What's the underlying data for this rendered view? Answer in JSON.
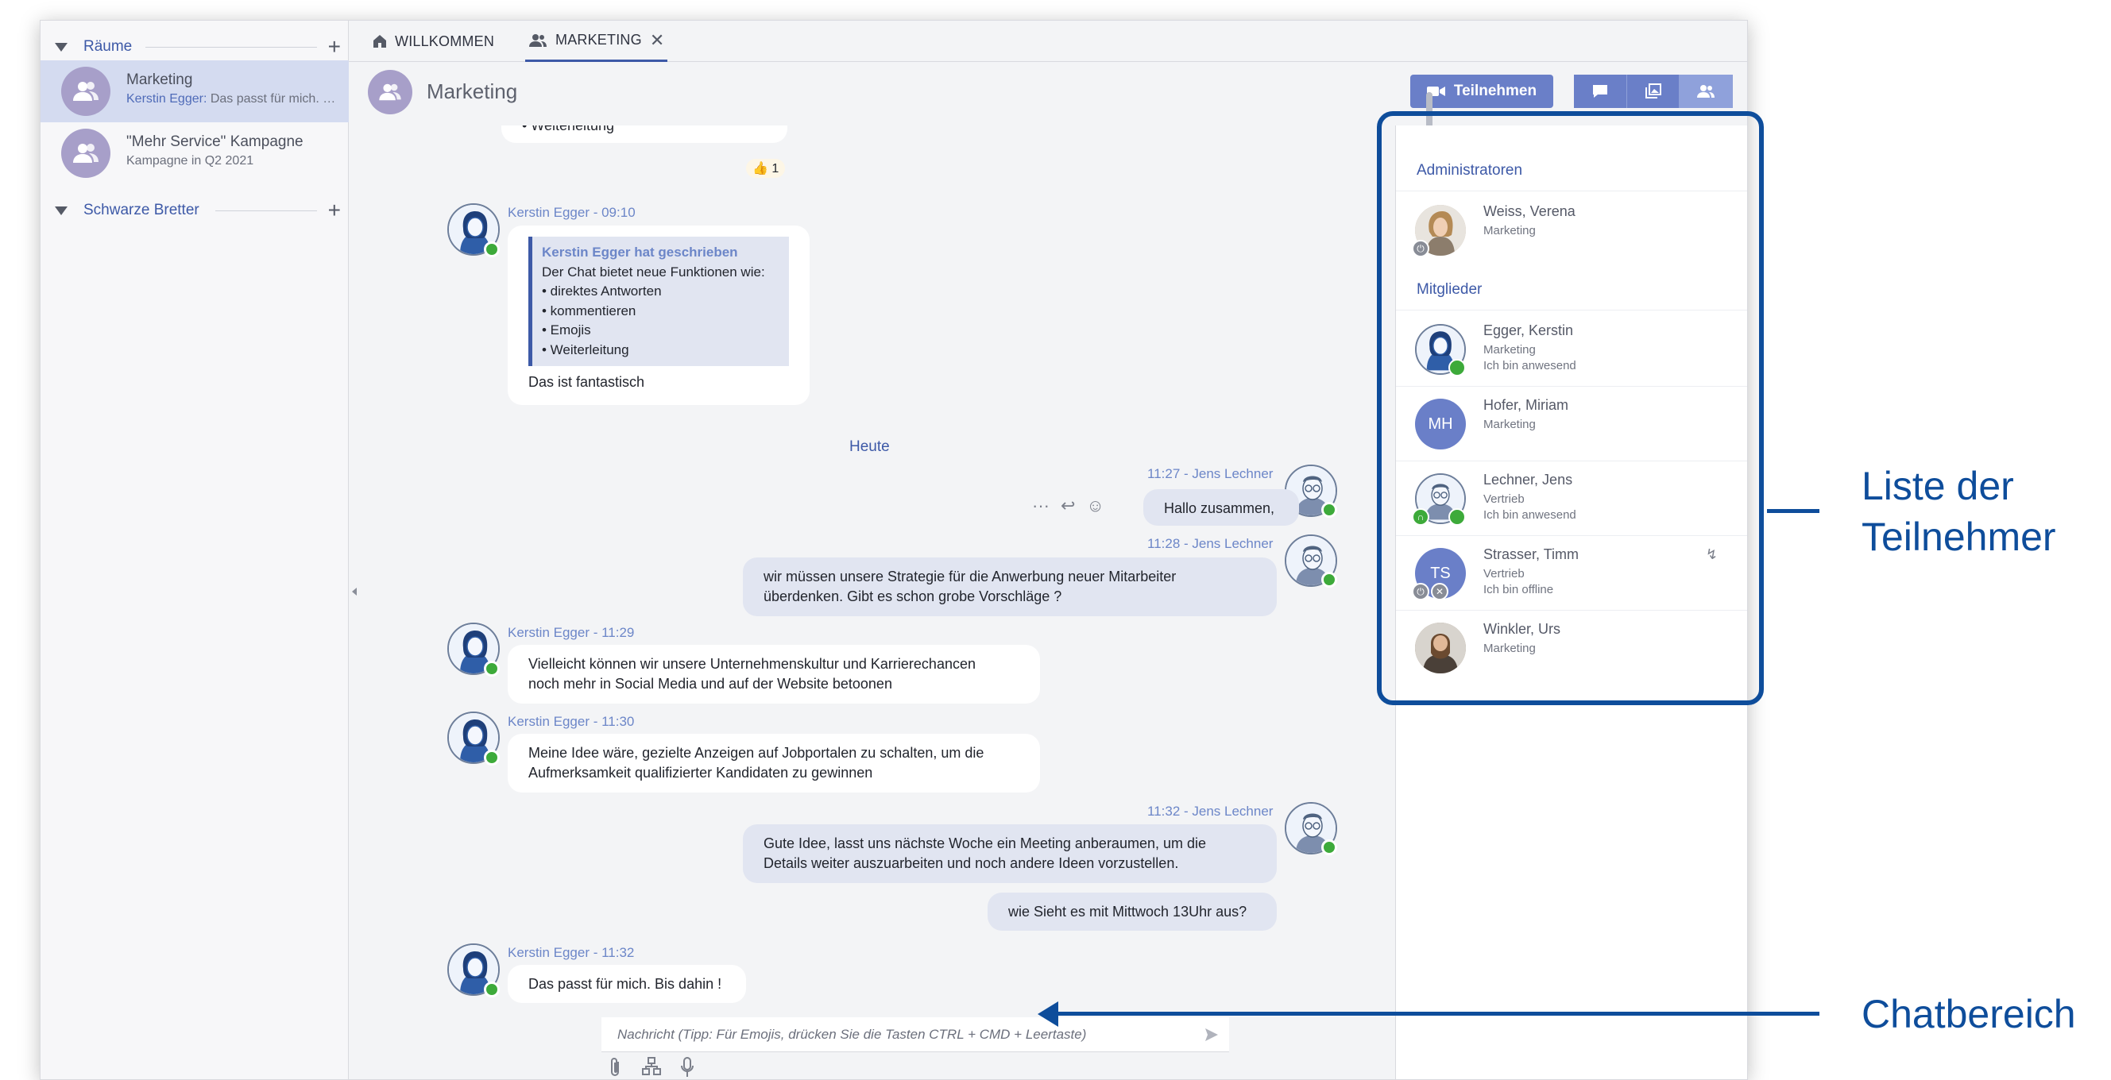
{
  "sidebar": {
    "rooms_section": {
      "label": "Räume"
    },
    "rooms": [
      {
        "name": "Marketing",
        "sender": "Kerstin Egger:",
        "preview": "Das passt für mich. B..."
      },
      {
        "name": "\"Mehr Service\" Kampagne",
        "preview": "Kampagne in Q2 2021"
      }
    ],
    "boards_section": {
      "label": "Schwarze Bretter"
    }
  },
  "tabs": [
    {
      "label": "WILLKOMMEN"
    },
    {
      "label": "MARKETING"
    }
  ],
  "room_header": {
    "title": "Marketing"
  },
  "toolbar": {
    "join_label": "Teilnehmen"
  },
  "chat": {
    "partial_top": "• Weiterleitung",
    "reaction": {
      "emoji": "👍",
      "count": "1"
    },
    "messages": [
      {
        "meta": "Kerstin Egger - 09:10",
        "quote_header": "Kerstin Egger hat geschrieben",
        "quote_lines": [
          "Der Chat bietet neue Funktionen wie:",
          "• direktes Antworten",
          "• kommentieren",
          "• Emojis",
          "• Weiterleitung"
        ],
        "text": "Das ist fantastisch"
      },
      {
        "meta": "11:27 - Jens Lechner",
        "text": "Hallo zusammen,"
      },
      {
        "meta": "11:28 - Jens Lechner",
        "line1": "wir müssen unsere Strategie für die Anwerbung neuer Mitarbeiter",
        "line2": "überdenken. Gibt es schon grobe Vorschläge ?"
      },
      {
        "meta": "Kerstin Egger - 11:29",
        "line1": "Vielleicht können wir unsere Unternehmenskultur und Karrierechancen",
        "line2": "noch mehr in Social Media und auf der Website betoonen"
      },
      {
        "meta": "Kerstin Egger - 11:30",
        "line1": "Meine Idee wäre, gezielte Anzeigen auf Jobportalen zu schalten, um die",
        "line2": "Aufmerksamkeit qualifizierter Kandidaten zu gewinnen"
      },
      {
        "meta": "11:32 - Jens Lechner",
        "line1": "Gute Idee, lasst uns nächste Woche ein Meeting anberaumen, um die",
        "line2": "Details weiter auszuarbeiten und noch andere Ideen vorzustellen."
      },
      {
        "text": "wie Sieht es mit Mittwoch 13Uhr aus?"
      },
      {
        "meta": "Kerstin Egger - 11:32",
        "text": "Das passt für mich. Bis dahin !"
      }
    ],
    "day_separator": "Heute",
    "input_placeholder": "Nachricht (Tipp: Für Emojis, drücken Sie die Tasten CTRL + CMD + Leertaste)"
  },
  "participants": {
    "admins_label": "Administratoren",
    "members_label": "Mitglieder",
    "admins": [
      {
        "name": "Weiss, Verena",
        "dept": "Marketing"
      }
    ],
    "members": [
      {
        "name": "Egger, Kerstin",
        "dept": "Marketing",
        "status": "Ich bin anwesend"
      },
      {
        "name": "Hofer, Miriam",
        "dept": "Marketing",
        "initials": "MH"
      },
      {
        "name": "Lechner, Jens",
        "dept": "Vertrieb",
        "status": "Ich bin anwesend"
      },
      {
        "name": "Strasser, Timm",
        "dept": "Vertrieb",
        "status": "Ich bin offline",
        "initials": "TS"
      },
      {
        "name": "Winkler, Urs",
        "dept": "Marketing"
      }
    ]
  },
  "annotations": {
    "participants_list": [
      "Liste der",
      "Teilnehmer"
    ],
    "chat_area": "Chatbereich"
  },
  "colors": {
    "accent": "#3d59a7",
    "annotation": "#0e4d9b",
    "online": "#3daa3a",
    "room_avatar": "#a79fc9",
    "button": "#6a7fc8"
  }
}
